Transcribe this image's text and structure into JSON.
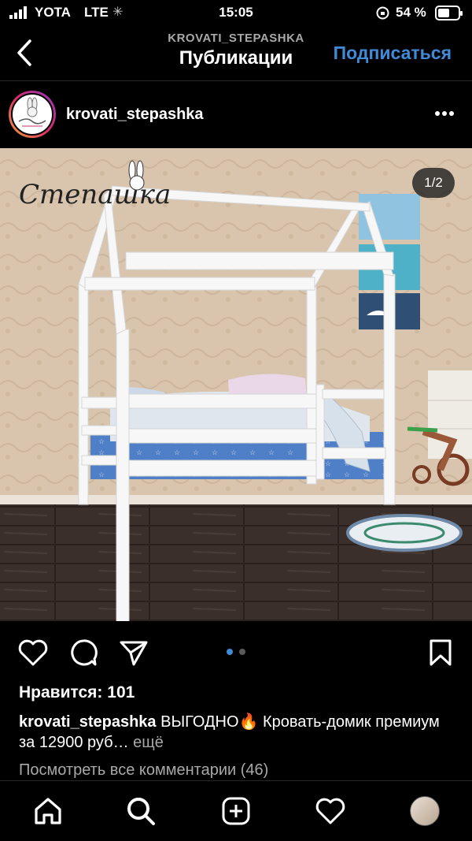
{
  "status_bar": {
    "carrier": "YOTA",
    "network": "LTE",
    "time": "15:05",
    "battery": "54 %"
  },
  "header": {
    "subtitle": "KROVATI_STEPASHKA",
    "title": "Публикации",
    "follow_label": "Подписаться"
  },
  "post": {
    "username": "krovati_stepashka",
    "counter": "1/2",
    "brand_logo_text": "Степашка",
    "likes": "Нравится: 101",
    "caption_user": "krovati_stepashka",
    "caption_text": "ВЫГОДНО",
    "caption_emoji": "🔥",
    "caption_text2": "Кровать-домик премиум за 12900 руб…",
    "more_label": "ещё",
    "comments_link": "Посмотреть все комментарии (46)",
    "carousel_active_index": 0,
    "carousel_total": 2
  },
  "colors": {
    "accent": "#3f8bd9",
    "secondary_text": "#a8a8a8"
  },
  "icons": [
    "signal-icon",
    "lte-activity-icon",
    "orientation-lock-icon",
    "battery-icon",
    "back-chevron-icon",
    "more-dots-icon",
    "heart-icon",
    "comment-icon",
    "share-send-icon",
    "bookmark-icon",
    "home-icon",
    "search-icon",
    "new-post-icon",
    "activity-heart-icon"
  ]
}
